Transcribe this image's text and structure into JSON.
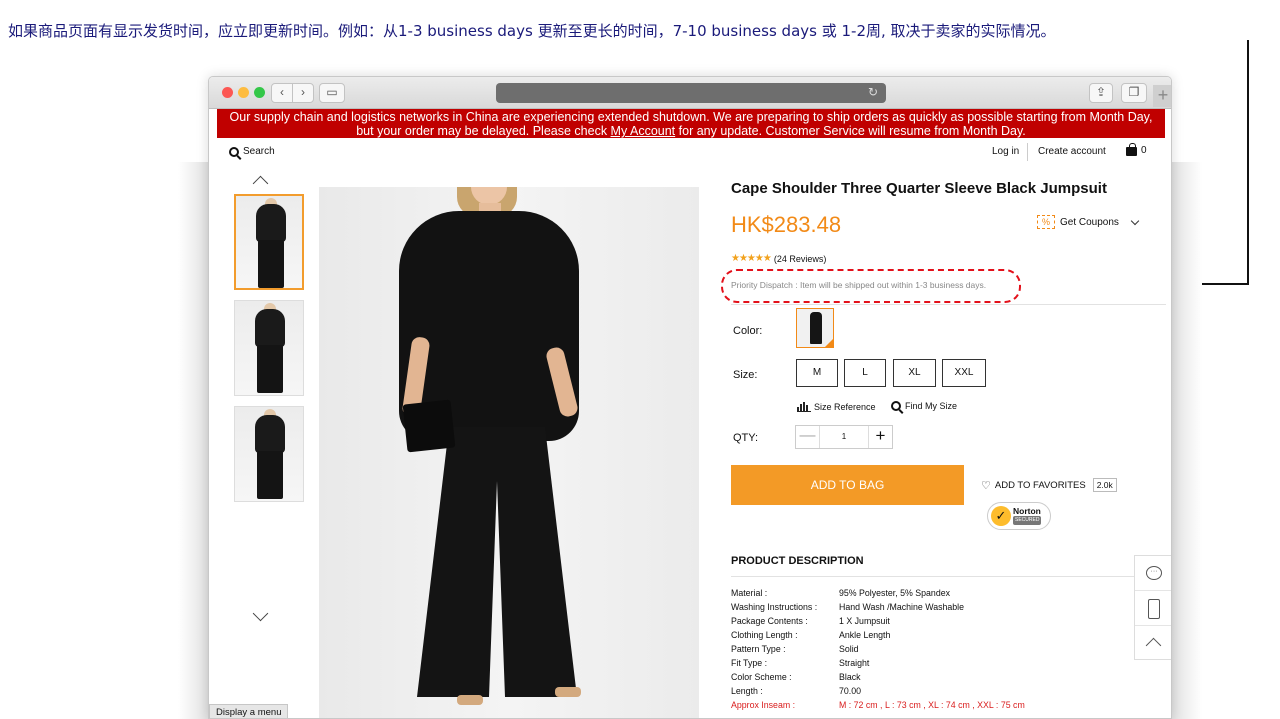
{
  "annotation": {
    "text": "如果商品页面有显示发货时间，应立即更新时间。例如：从1-3 business days 更新至更长的时间，7-10 business days 或 1-2周, 取决于卖家的实际情况。"
  },
  "notice": {
    "line1": "Our supply chain and logistics networks in China are experiencing extended shutdown. We are preparing to ship orders as quickly as possible starting from Month Day,",
    "line2_before": "but your order may be delayed. Please check ",
    "line2_link": "My Account",
    "line2_after": " for any update. Customer Service will resume from Month Day."
  },
  "topnav": {
    "search": "Search",
    "login": "Log in",
    "create_account": "Create account",
    "cart_count": "0"
  },
  "product": {
    "title": "Cape Shoulder Three Quarter Sleeve Black Jumpsuit",
    "price": "HK$283.48",
    "coupon_icon": "%",
    "coupon_label": "Get Coupons",
    "stars": "★★★★★",
    "rating": 4.5,
    "reviews": "(24 Reviews)",
    "dispatch": "Priority Dispatch : Item will be shipped out within 1-3 business days.",
    "color_label": "Color:",
    "size_label": "Size:",
    "sizes": [
      "M",
      "L",
      "XL",
      "XXL"
    ],
    "size_reference": "Size Reference",
    "find_my_size": "Find My Size",
    "qty_label": "QTY:",
    "qty_minus": "—",
    "qty_value": "1",
    "qty_plus": "+",
    "add_to_bag": "ADD TO BAG",
    "heart_icon": "♡",
    "favorites_label": "ADD TO FAVORITES",
    "favorites_count": "2.0k",
    "norton_check": "✓",
    "norton_brand": "Norton",
    "norton_sub": "SECURED"
  },
  "description": {
    "heading": "PRODUCT DESCRIPTION",
    "specs": [
      {
        "k": "Material :",
        "v": "95% Polyester, 5% Spandex"
      },
      {
        "k": "Washing Instructions :",
        "v": "Hand Wash /Machine Washable"
      },
      {
        "k": "Package Contents :",
        "v": "1 X Jumpsuit"
      },
      {
        "k": "Clothing Length :",
        "v": "Ankle Length"
      },
      {
        "k": "Pattern Type :",
        "v": "Solid"
      },
      {
        "k": "Fit Type :",
        "v": "Straight"
      },
      {
        "k": "Color Scheme :",
        "v": "Black"
      },
      {
        "k": "Length :",
        "v": "70.00"
      },
      {
        "k": "Approx Inseam :",
        "v": "M : 72 cm , L : 73 cm , XL : 74 cm , XXL : 75 cm"
      }
    ]
  },
  "floating": {
    "chat_icon": "···"
  },
  "status_tip": "Display a menu",
  "colors": {
    "accent": "#f39a26",
    "notice_bg": "#c00000",
    "highlight": "#e3101a"
  }
}
